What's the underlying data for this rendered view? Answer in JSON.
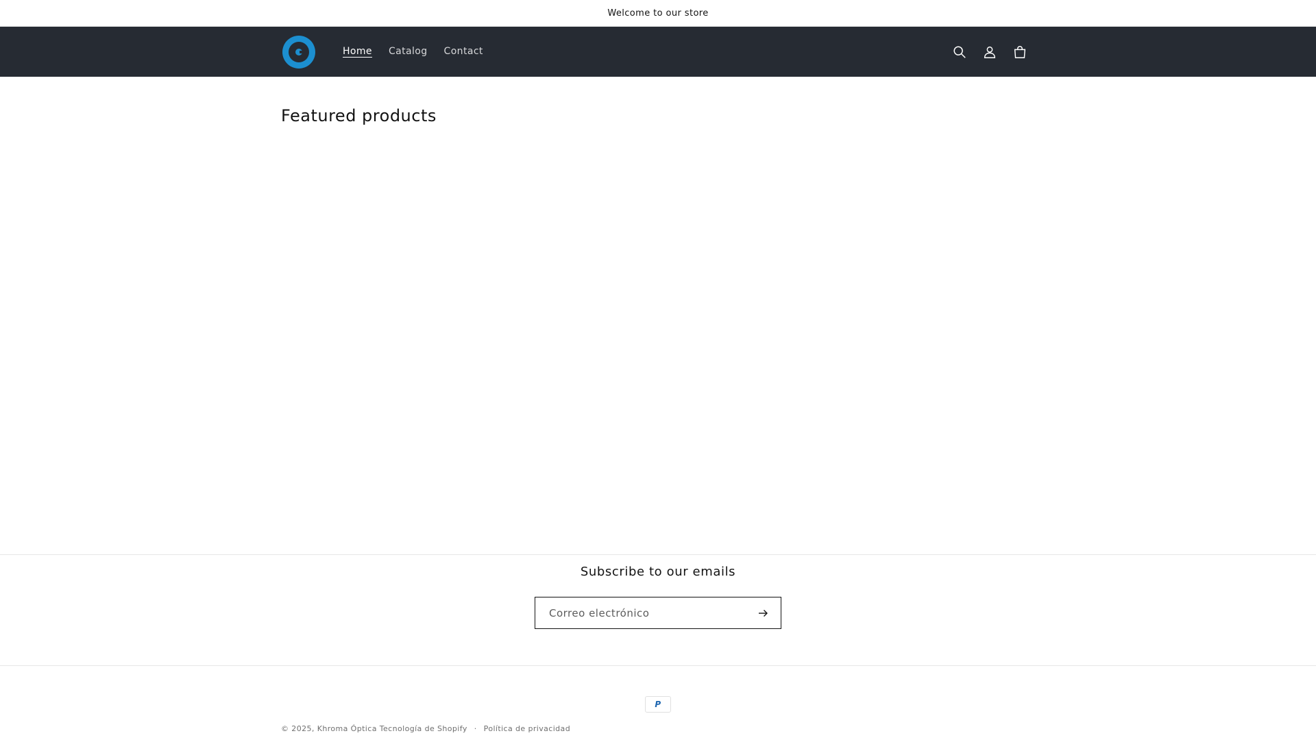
{
  "announcement": {
    "text": "Welcome to our store"
  },
  "header": {
    "nav": [
      {
        "label": "Home",
        "active": true
      },
      {
        "label": "Catalog",
        "active": false
      },
      {
        "label": "Contact",
        "active": false
      }
    ],
    "icons": [
      "search-icon",
      "account-icon",
      "cart-icon"
    ]
  },
  "featured": {
    "title": "Featured products"
  },
  "newsletter": {
    "title": "Subscribe to our emails",
    "placeholder": "Correo electrónico",
    "value": ""
  },
  "payment": {
    "label": "P"
  },
  "footer": {
    "copyright_prefix": "© 2025,",
    "store_name": "Khroma Óptica",
    "powered_by": "Tecnología de Shopify",
    "separator": "·",
    "privacy_link": "Política de privacidad"
  },
  "colors": {
    "header_bg": "#262b33",
    "logo_blue": "#1c8fd0",
    "text": "#121212"
  }
}
